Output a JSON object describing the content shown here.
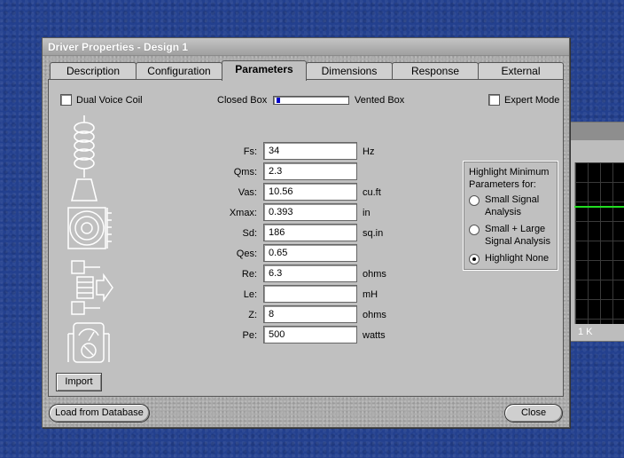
{
  "background": {
    "axis_label": "1 K"
  },
  "window": {
    "title": "Driver Properties - Design 1"
  },
  "tabs": [
    {
      "label": "Description",
      "active": false
    },
    {
      "label": "Configuration",
      "active": false
    },
    {
      "label": "Parameters",
      "active": true
    },
    {
      "label": "Dimensions",
      "active": false
    },
    {
      "label": "Response",
      "active": false
    },
    {
      "label": "External",
      "active": false
    }
  ],
  "options": {
    "dual_voice_coil": {
      "label": "Dual Voice Coil",
      "checked": false
    },
    "expert_mode": {
      "label": "Expert Mode",
      "checked": false
    },
    "box_slider": {
      "left_label": "Closed Box",
      "right_label": "Vented Box",
      "value": 0.05
    }
  },
  "params": [
    {
      "label": "Fs:",
      "value": "34",
      "unit": "Hz"
    },
    {
      "label": "Qms:",
      "value": "2.3",
      "unit": ""
    },
    {
      "label": "Vas:",
      "value": "10.56",
      "unit": "cu.ft"
    },
    {
      "label": "Xmax:",
      "value": "0.393",
      "unit": "in"
    },
    {
      "label": "Sd:",
      "value": "186",
      "unit": "sq.in"
    },
    {
      "label": "Qes:",
      "value": "0.65",
      "unit": ""
    },
    {
      "label": "Re:",
      "value": "6.3",
      "unit": "ohms"
    },
    {
      "label": "Le:",
      "value": "",
      "unit": "mH"
    },
    {
      "label": "Z:",
      "value": "8",
      "unit": "ohms"
    },
    {
      "label": "Pe:",
      "value": "500",
      "unit": "watts"
    }
  ],
  "highlight": {
    "title_line1": "Highlight Minimum",
    "title_line2": "Parameters for:",
    "options": [
      {
        "line1": "Small Signal",
        "line2": "Analysis",
        "selected": false
      },
      {
        "line1": "Small + Large",
        "line2": "Signal Analysis",
        "selected": false
      },
      {
        "line1": "Highlight None",
        "line2": "",
        "selected": true
      }
    ]
  },
  "buttons": {
    "import": "Import",
    "load_from_database": "Load from Database",
    "close": "Close"
  },
  "icons": [
    "voice-coil-icon",
    "cone-icon",
    "speaker-front-icon",
    "magnet-motor-icon",
    "meter-icon"
  ]
}
